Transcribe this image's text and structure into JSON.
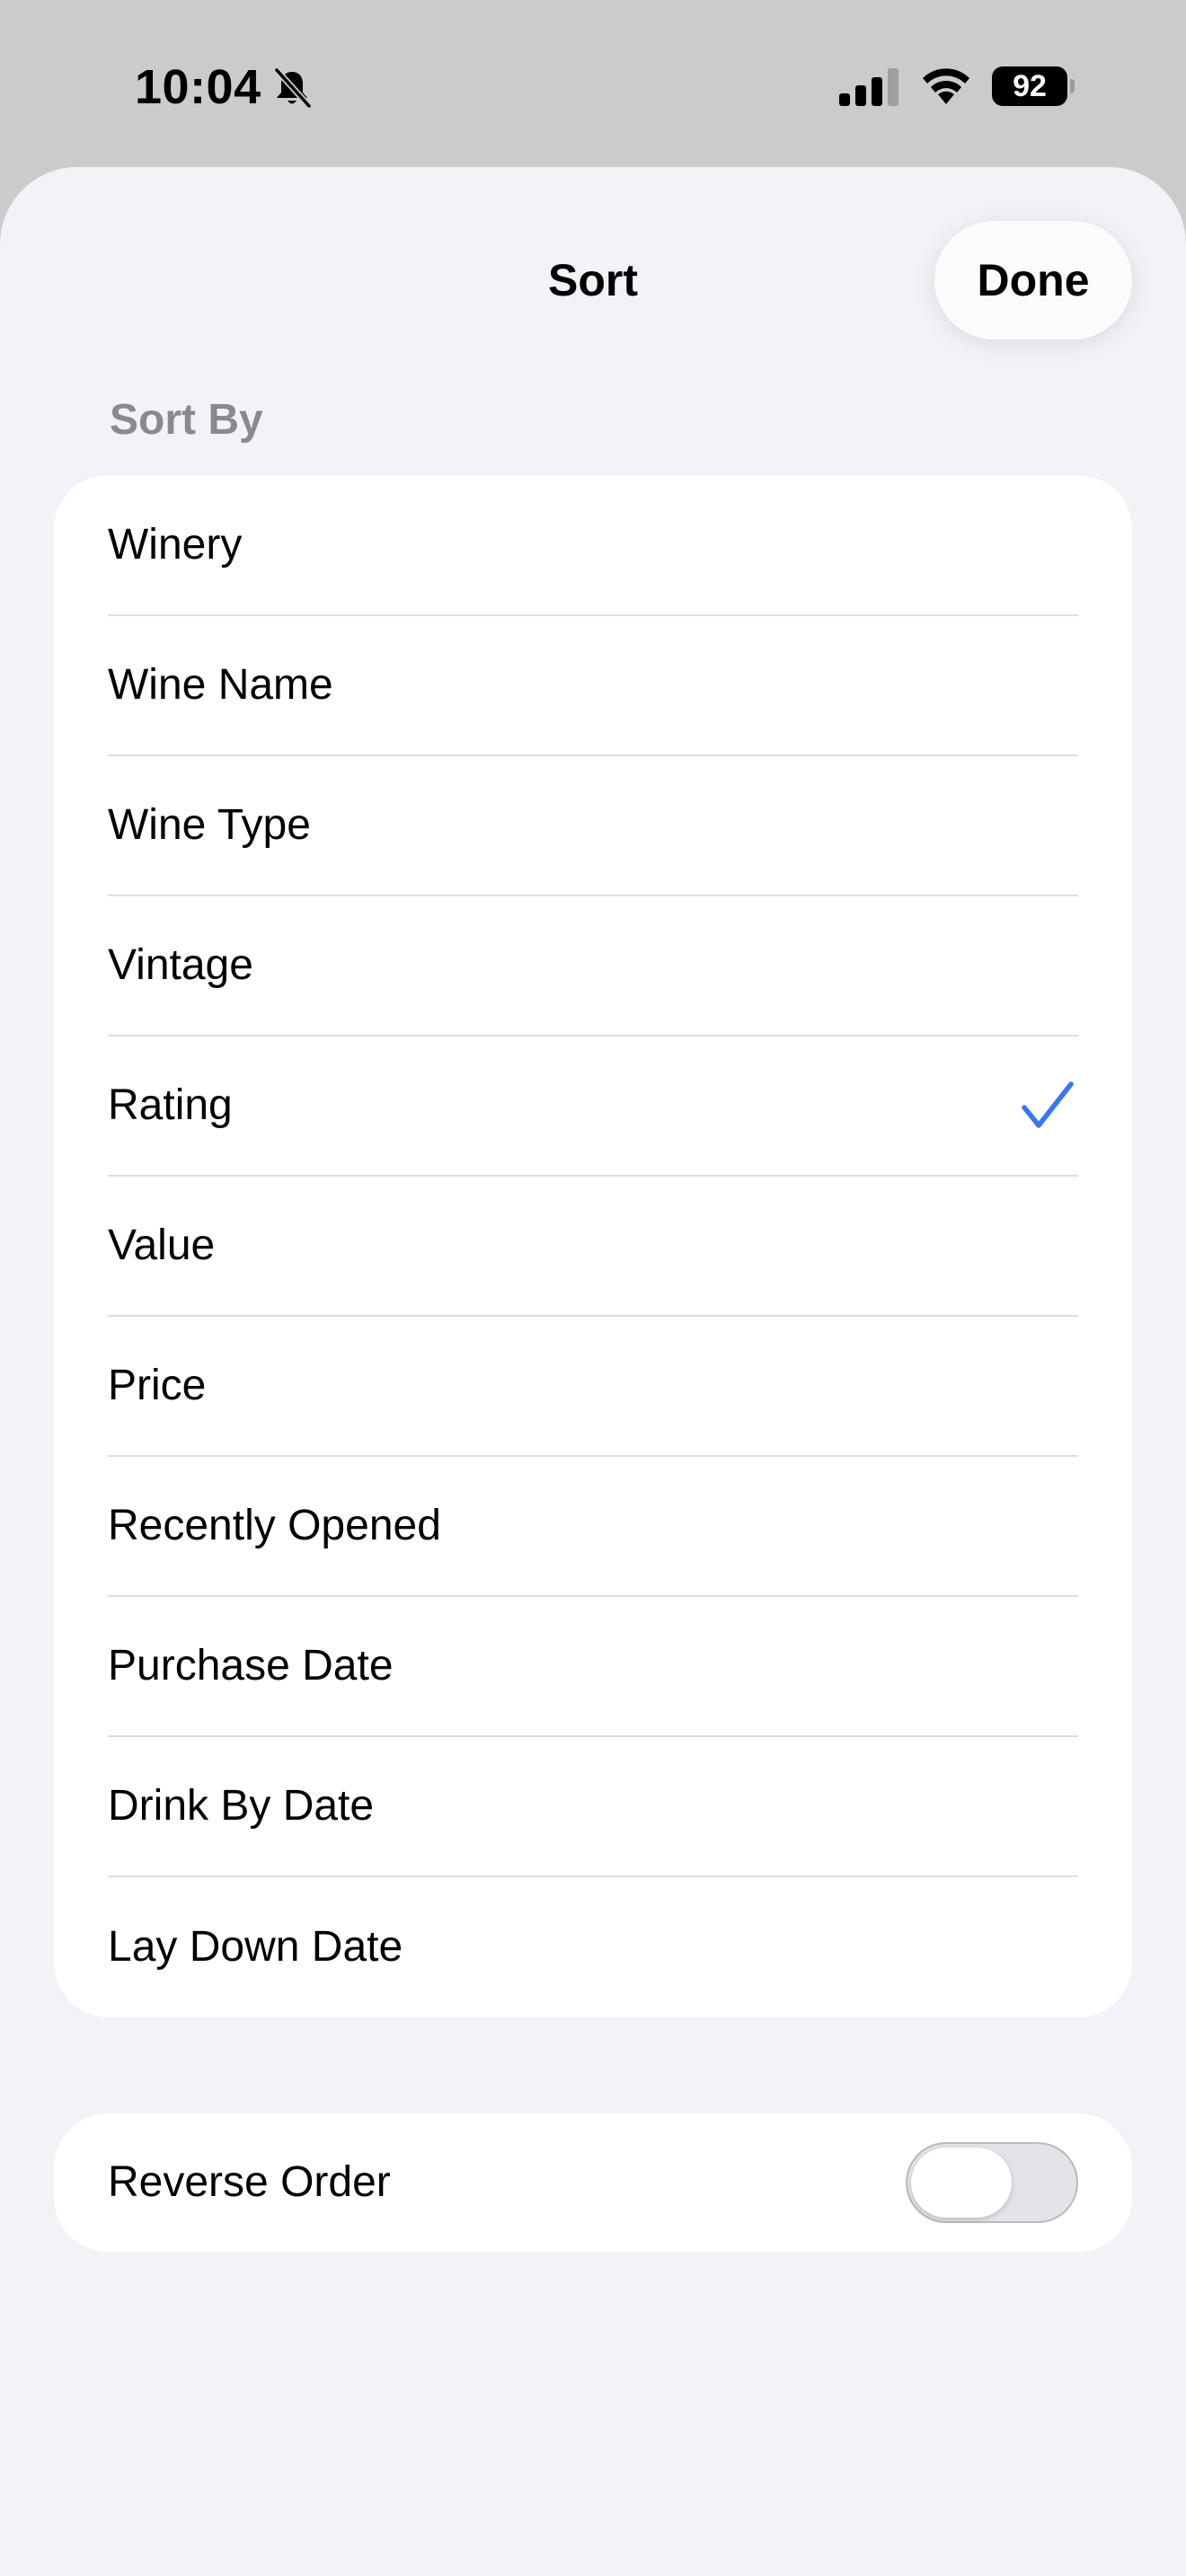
{
  "status_bar": {
    "time": "10:04",
    "battery_level": "92",
    "icons": [
      "bell-slash-icon",
      "cellular-signal-icon",
      "wifi-icon",
      "battery-icon"
    ]
  },
  "sheet": {
    "title": "Sort",
    "done_label": "Done"
  },
  "sort_section": {
    "header": "Sort By",
    "options": [
      {
        "label": "Winery",
        "selected": false
      },
      {
        "label": "Wine Name",
        "selected": false
      },
      {
        "label": "Wine Type",
        "selected": false
      },
      {
        "label": "Vintage",
        "selected": false
      },
      {
        "label": "Rating",
        "selected": true
      },
      {
        "label": "Value",
        "selected": false
      },
      {
        "label": "Price",
        "selected": false
      },
      {
        "label": "Recently Opened",
        "selected": false
      },
      {
        "label": "Purchase Date",
        "selected": false
      },
      {
        "label": "Drink By Date",
        "selected": false
      },
      {
        "label": "Lay Down Date",
        "selected": false
      }
    ]
  },
  "reverse_section": {
    "label": "Reverse Order",
    "enabled": false
  },
  "colors": {
    "accent": "#3478f6",
    "background": "#f2f2f7",
    "card": "#ffffff",
    "secondary_text": "#8a8a8e"
  }
}
